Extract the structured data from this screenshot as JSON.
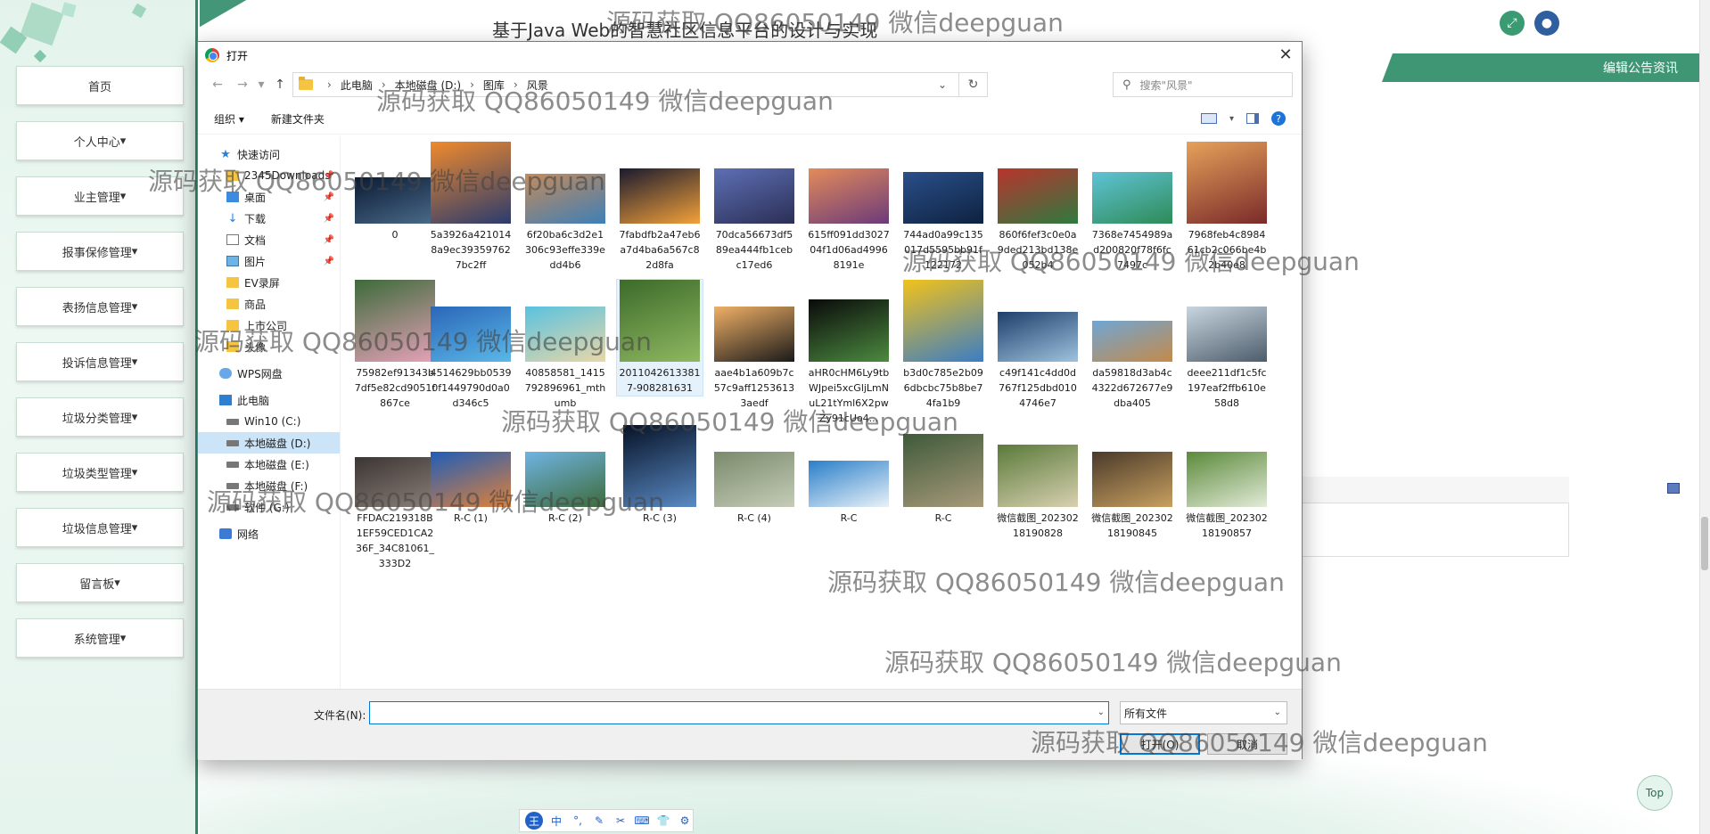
{
  "app": {
    "page_title": "基于Java Web的智慧社区信息平台的设计与实现",
    "ribbon": "编辑公告资讯",
    "top_button": "Top"
  },
  "sidebar": {
    "items": [
      {
        "label": "首页"
      },
      {
        "label": "个人中心"
      },
      {
        "label": "业主管理"
      },
      {
        "label": "报事保修管理"
      },
      {
        "label": "表扬信息管理"
      },
      {
        "label": "投诉信息管理"
      },
      {
        "label": "垃圾分类管理"
      },
      {
        "label": "垃圾类型管理"
      },
      {
        "label": "垃圾信息管理"
      },
      {
        "label": "留言板"
      },
      {
        "label": "系统管理"
      }
    ]
  },
  "dialog": {
    "title": "打开",
    "close": "✕",
    "breadcrumb": [
      "此电脑",
      "本地磁盘 (D:)",
      "图库",
      "风景"
    ],
    "search_placeholder": "搜索\"风景\"",
    "organize": "组织 ▾",
    "new_folder": "新建文件夹",
    "nav": [
      {
        "label": "快速访问",
        "icon": "star-icon"
      },
      {
        "label": "2345Downloads",
        "icon": "folder-icon",
        "pin": true
      },
      {
        "label": "桌面",
        "icon": "desktop-icon",
        "pin": true
      },
      {
        "label": "下载",
        "icon": "download-icon",
        "pin": true
      },
      {
        "label": "文档",
        "icon": "document-icon",
        "pin": true
      },
      {
        "label": "图片",
        "icon": "picture-icon",
        "pin": true
      },
      {
        "label": "EV录屏",
        "icon": "folder-icon"
      },
      {
        "label": "商品",
        "icon": "folder-icon"
      },
      {
        "label": "上市公司",
        "icon": "folder-icon"
      },
      {
        "label": "头像",
        "icon": "folder-icon"
      },
      {
        "label": "WPS网盘",
        "icon": "cloud-icon"
      },
      {
        "label": "此电脑",
        "icon": "computer-icon"
      },
      {
        "label": "Win10 (C:)",
        "icon": "drive-icon"
      },
      {
        "label": "本地磁盘 (D:)",
        "icon": "drive-icon"
      },
      {
        "label": "本地磁盘 (E:)",
        "icon": "drive-icon"
      },
      {
        "label": "本地磁盘 (F:)",
        "icon": "drive-icon"
      },
      {
        "label": "软件 (G:)",
        "icon": "drive-icon"
      },
      {
        "label": "网络",
        "icon": "network-icon"
      }
    ],
    "files": [
      {
        "name": "0",
        "c1": "#0b1a33",
        "c2": "#4a6b8a"
      },
      {
        "name": "5a3926a4210148a9ec393597627bc2ff",
        "c1": "#f08a2c",
        "c2": "#2a3b6e"
      },
      {
        "name": "6f20ba6c3d2e1306c93effe339edd4b6",
        "c1": "#c58b5a",
        "c2": "#3d7fb8"
      },
      {
        "name": "7fabdfb2a47eb6a7d4ba6a567c82d8fa",
        "c1": "#1a1a2e",
        "c2": "#f3a13a"
      },
      {
        "name": "70dca56673df589ea444fb1cebc17ed6",
        "c1": "#5d6fb5",
        "c2": "#2b2f55"
      },
      {
        "name": "615ff091dd302704f1d06ad49968191e",
        "c1": "#e38b5a",
        "c2": "#6b3a7a"
      },
      {
        "name": "744ad0a99c135017d5595bb91f122172",
        "c1": "#2a4f8a",
        "c2": "#0e2240"
      },
      {
        "name": "860f6fef3c0e0a9ded213bd138e052b4",
        "c1": "#b9342e",
        "c2": "#2e7a3f"
      },
      {
        "name": "7368e7454989ad200820f78f6fc7497c",
        "c1": "#5fc3d6",
        "c2": "#2e8b57"
      },
      {
        "name": "7968feb4c898461cb2c066be4b2b40e8",
        "c1": "#e6a15a",
        "c2": "#7a2a2a"
      },
      {
        "name": "75982ef91343b7df5e82cd9051f867ce",
        "c1": "#3d6b3a",
        "c2": "#e5a1b8"
      },
      {
        "name": "4514629bb05390f1449790d0a0d346c5",
        "c1": "#2a66b8",
        "c2": "#5bb8e8"
      },
      {
        "name": "40858581_1415792896961_mthumb",
        "c1": "#59c2e0",
        "c2": "#e8d7a8"
      },
      {
        "name": "20110426133817-908281631",
        "c1": "#3c6b2a",
        "c2": "#8fb860"
      },
      {
        "name": "aae4b1a609b7c57c9aff12536133aedf",
        "c1": "#f0b066",
        "c2": "#1a1a1a"
      },
      {
        "name": "aHR0cHM6Ly9tbWJpei5xcGljLmNuL21tYml6X2pwZy91cUo4...",
        "c1": "#0a0a0a",
        "c2": "#4b8a3f"
      },
      {
        "name": "b3d0c785e2b096dbcbc75b8be74fa1b9",
        "c1": "#f2c21a",
        "c2": "#3b7dc4"
      },
      {
        "name": "c49f141c4dd0d767f125dbd0104746e7",
        "c1": "#1d3f6b",
        "c2": "#9fc2de"
      },
      {
        "name": "da59818d3ab4c4322d672677e9dba405",
        "c1": "#6fa6d4",
        "c2": "#c48a4a"
      },
      {
        "name": "deee211df1c5fc197eaf2ffb610e58d8",
        "c1": "#c8d6e0",
        "c2": "#4d5c6b"
      },
      {
        "name": "FFDAC219318B1EF59CED1CA236F_34C81061_333D2",
        "c1": "#3b3533",
        "c2": "#8a7f78"
      },
      {
        "name": "R-C (1)",
        "c1": "#1f5db8",
        "c2": "#e0813a"
      },
      {
        "name": "R-C (2)",
        "c1": "#6fb4e3",
        "c2": "#3d6b3a"
      },
      {
        "name": "R-C (3)",
        "c1": "#061226",
        "c2": "#5a8ac4"
      },
      {
        "name": "R-C (4)",
        "c1": "#7a8a6b",
        "c2": "#c5ccb8"
      },
      {
        "name": "R-C",
        "c1": "#2a7fc9",
        "c2": "#e9f1f8"
      },
      {
        "name": "R-C",
        "c1": "#3e5a3a",
        "c2": "#a89a7a"
      },
      {
        "name": "微信截图_20230218190828",
        "c1": "#5a7a3a",
        "c2": "#d8d0b0"
      },
      {
        "name": "微信截图_20230218190845",
        "c1": "#4a3a2a",
        "c2": "#c8a060"
      },
      {
        "name": "微信截图_20230218190857",
        "c1": "#5b8a3a",
        "c2": "#e2ead8"
      }
    ],
    "filename_label": "文件名(N):",
    "filename_value": "",
    "filetype": "所有文件",
    "open": "打开(O)",
    "cancel": "取消"
  },
  "ime": [
    "中",
    "°,",
    "✎",
    "✂",
    "⌨",
    "👕",
    "⚙"
  ],
  "watermark": "源码获取 QQ86050149 微信deepguan"
}
